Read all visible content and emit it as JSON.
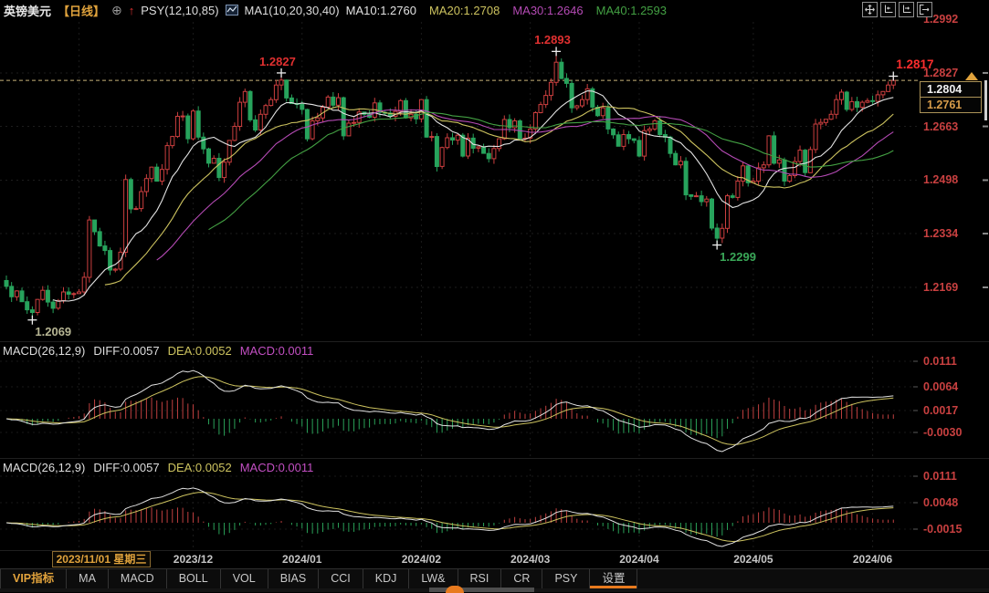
{
  "header": {
    "symbol": "英镑美元",
    "period": "【日线】",
    "psy_label": "PSY(12,10,85)",
    "ma_group_label": "MA1(10,20,30,40)",
    "ma_values": [
      {
        "label": "MA10:1.2760",
        "color": "#e2e2e2"
      },
      {
        "label": "MA20:1.2708",
        "color": "#cdc35f"
      },
      {
        "label": "MA30:1.2646",
        "color": "#b44ab4"
      },
      {
        "label": "MA40:1.2593",
        "color": "#43a043"
      }
    ]
  },
  "price_box": {
    "primary": "1.2804",
    "secondary": "1.2761"
  },
  "macd1": {
    "title": "MACD(26,12,9)",
    "diff": "DIFF:0.0057",
    "dea": "DEA:0.0052",
    "macd": "MACD:0.0011",
    "axis": [
      "0.0111",
      "0.0064",
      "0.0017",
      "-0.0030"
    ]
  },
  "macd2": {
    "title": "MACD(26,12,9)",
    "diff": "DIFF:0.0057",
    "dea": "DEA:0.0052",
    "macd": "MACD:0.0011",
    "axis": [
      "0.0111",
      "0.0048",
      "-0.0015"
    ]
  },
  "xaxis": {
    "highlight": "2023/11/01 星期三"
  },
  "footer": {
    "items": [
      "VIP指标",
      "MA",
      "MACD",
      "BOLL",
      "VOL",
      "BIAS",
      "CCI",
      "KDJ",
      "LW&",
      "RSI",
      "CR",
      "PSY",
      "设置"
    ],
    "accent_item": "VIP指标",
    "underline_item": "设置"
  },
  "colors": {
    "up": "#cc3f3f",
    "down": "#27a35c",
    "ma": [
      "#e2e2e2",
      "#cdc35f",
      "#b44ab4",
      "#43a043"
    ],
    "macd_pos": "#c04040",
    "macd_neg": "#2aa158",
    "diff_line": "#e2e2e2",
    "dea_line": "#cdc35f",
    "axis_red": "#c84040",
    "dashed_line": "#c8b37a",
    "cross": "#eeeeee",
    "high_annotation": "#e03030",
    "low_annotation": "#3aa858",
    "accent_orange": "#dfa23c"
  },
  "chart_data": {
    "type": "candlestick",
    "title": "英镑美元 日线 (GBP/USD daily)",
    "y_axis_levels": [
      1.2992,
      1.2827,
      1.2663,
      1.2498,
      1.2334,
      1.2169
    ],
    "current_price": 1.2804,
    "first_open": 1.219,
    "closes": [
      1.2172,
      1.214,
      1.2158,
      1.2125,
      1.21,
      1.2092,
      1.2132,
      1.216,
      1.2124,
      1.2105,
      1.2128,
      1.2155,
      1.2148,
      1.215,
      1.2155,
      1.22,
      1.2376,
      1.234,
      1.2296,
      1.2282,
      1.2222,
      1.2225,
      1.2277,
      1.25,
      1.241,
      1.2411,
      1.2463,
      1.2503,
      1.2538,
      1.2495,
      1.2531,
      1.2604,
      1.2632,
      1.2694,
      1.2695,
      1.2625,
      1.271,
      1.263,
      1.2594,
      1.255,
      1.2565,
      1.2506,
      1.2553,
      1.262,
      1.2663,
      1.2737,
      1.277,
      1.2683,
      1.2652,
      1.27,
      1.2727,
      1.2745,
      1.279,
      1.2805,
      1.275,
      1.2733,
      1.2731,
      1.2715,
      1.2625,
      1.268,
      1.2689,
      1.2722,
      1.2753,
      1.2728,
      1.2751,
      1.2634,
      1.2673,
      1.2675,
      1.2707,
      1.27,
      1.2691,
      1.2735,
      1.2706,
      1.2704,
      1.2694,
      1.2709,
      1.2742,
      1.2689,
      1.27,
      1.2686,
      1.2745,
      1.263,
      1.2632,
      1.254,
      1.2598,
      1.2628,
      1.2621,
      1.2636,
      1.2572,
      1.2627,
      1.2596,
      1.26,
      1.258,
      1.2564,
      1.2595,
      1.2625,
      1.2684,
      1.2659,
      1.268,
      1.2625,
      1.2627,
      1.2655,
      1.2705,
      1.273,
      1.2758,
      1.2798,
      1.286,
      1.281,
      1.2795,
      1.272,
      1.2726,
      1.2745,
      1.2778,
      1.2722,
      1.2696,
      1.272,
      1.2655,
      1.2637,
      1.2602,
      1.2638,
      1.2625,
      1.262,
      1.2572,
      1.265,
      1.2655,
      1.268,
      1.2638,
      1.263,
      1.258,
      1.2545,
      1.2556,
      1.2453,
      1.2448,
      1.245,
      1.2432,
      1.244,
      1.2351,
      1.232,
      1.235,
      1.245,
      1.2445,
      1.2495,
      1.2542,
      1.249,
      1.2495,
      1.2536,
      1.2545,
      1.2634,
      1.255,
      1.256,
      1.2495,
      1.2512,
      1.2555,
      1.259,
      1.2521,
      1.2592,
      1.267,
      1.2675,
      1.2685,
      1.27,
      1.2745,
      1.2768,
      1.2715,
      1.2739,
      1.2722,
      1.2737,
      1.2742,
      1.274,
      1.276,
      1.277,
      1.279,
      1.2804
    ],
    "wick_overrides": [
      {
        "bar": 5,
        "low": 1.2069
      },
      {
        "bar": 53,
        "high": 1.2827
      },
      {
        "bar": 106,
        "high": 1.2893
      },
      {
        "bar": 137,
        "low": 1.2299
      },
      {
        "bar": 171,
        "high": 1.2817
      }
    ],
    "months": [
      {
        "label": "2023/12",
        "bar": 36
      },
      {
        "label": "2024/01",
        "bar": 57
      },
      {
        "label": "2024/02",
        "bar": 80
      },
      {
        "label": "2024/03",
        "bar": 101
      },
      {
        "label": "2024/04",
        "bar": 122
      },
      {
        "label": "2024/05",
        "bar": 144
      },
      {
        "label": "2024/06",
        "bar": 167
      }
    ],
    "annotations": [
      {
        "text": "1.2827",
        "bar": 53,
        "price": 1.2827,
        "color": "#e03030",
        "placement": "above",
        "bold": true
      },
      {
        "text": "1.2893",
        "bar": 106,
        "price": 1.2893,
        "color": "#e03030",
        "placement": "above",
        "bold": true
      },
      {
        "text": "1.2299",
        "bar": 137,
        "price": 1.2299,
        "color": "#3aa858",
        "placement": "below-right",
        "bold": true
      },
      {
        "text": "1.2069",
        "bar": 5,
        "price": 1.2069,
        "color": "#b7b694",
        "placement": "below-right",
        "bold": true
      },
      {
        "text": "1.2817",
        "bar": 171,
        "price": 1.2817,
        "color": "#fb2d2d",
        "placement": "above-right",
        "bold": true
      }
    ],
    "ma_periods": [
      10,
      20,
      30,
      40
    ],
    "indicator_panels": [
      {
        "type": "macd",
        "params": [
          26,
          12,
          9
        ],
        "last": {
          "diff": 0.0057,
          "dea": 0.0052,
          "macd": 0.0011
        },
        "y_axis_levels": [
          0.0111,
          0.0064,
          0.0017,
          -0.003
        ]
      },
      {
        "type": "macd",
        "params": [
          26,
          12,
          9
        ],
        "last": {
          "diff": 0.0057,
          "dea": 0.0052,
          "macd": 0.0011
        },
        "y_axis_levels": [
          0.0111,
          0.0048,
          -0.0015
        ]
      }
    ]
  }
}
